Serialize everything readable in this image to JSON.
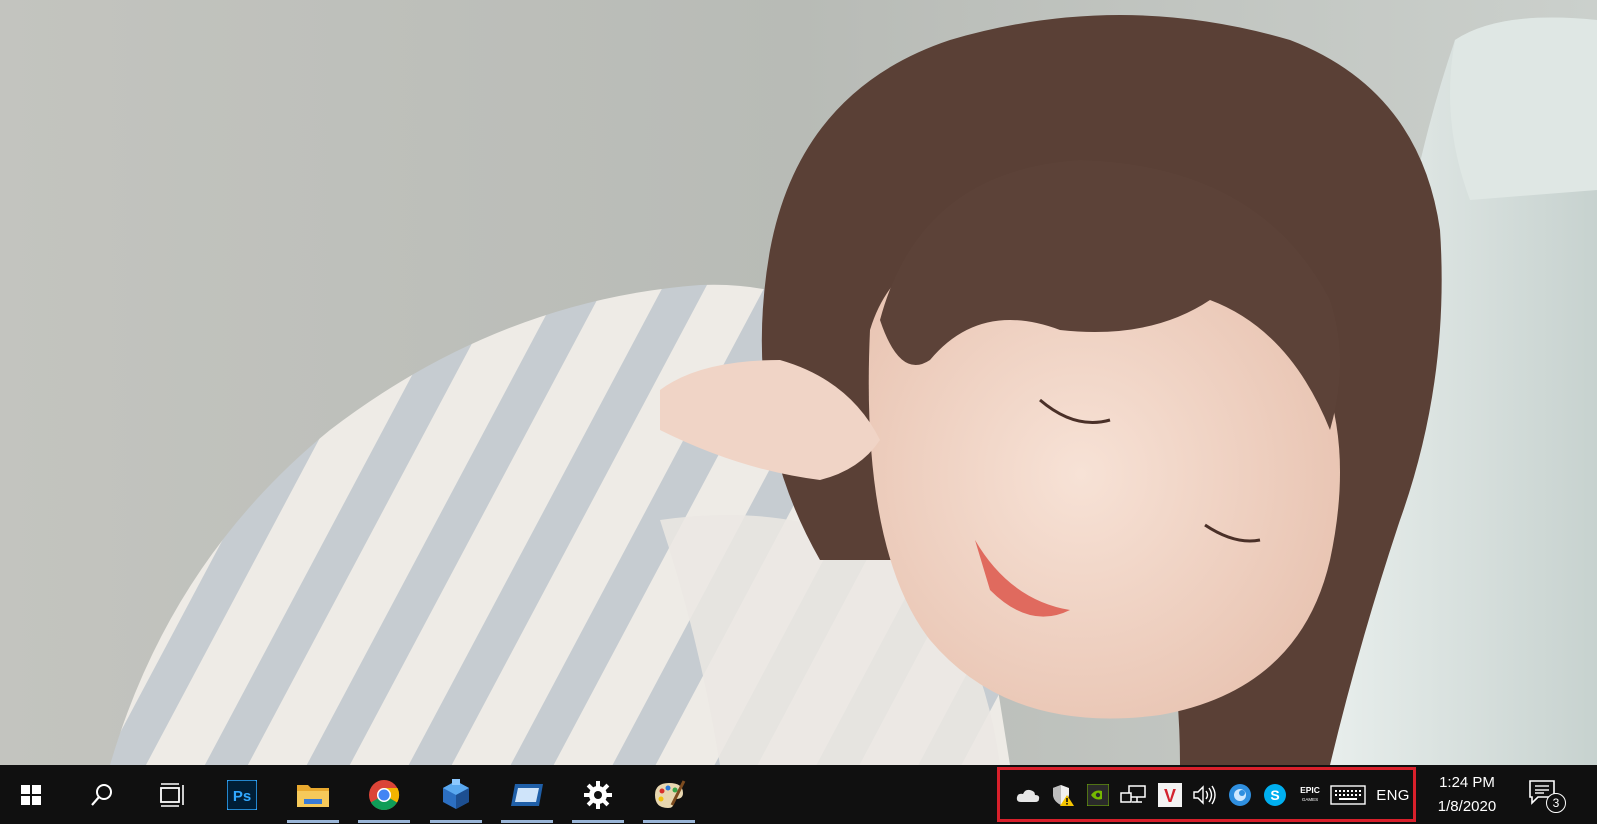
{
  "taskbar": {
    "start_label": "Start",
    "search_label": "Search",
    "task_view_label": "Task View",
    "pinned": [
      {
        "name": "photoshop",
        "glyph": "Ps",
        "color": "#31a8ff"
      },
      {
        "name": "file-explorer",
        "color": "#f4c152"
      },
      {
        "name": "chrome"
      },
      {
        "name": "app-cube",
        "color": "#3a8fe0"
      },
      {
        "name": "app-window",
        "color": "#3a8fe0"
      },
      {
        "name": "settings"
      },
      {
        "name": "paint"
      }
    ],
    "tray": {
      "icons": [
        "onedrive-icon",
        "defender-warning-icon",
        "nvidia-icon",
        "network-icon",
        "v-app-icon",
        "volume-icon",
        "blue-circle-app-icon",
        "skype-icon",
        "epic-games-icon",
        "touch-keyboard-icon"
      ],
      "vapp_glyph": "V",
      "skype_glyph": "S",
      "epic_glyph_top": "EPIC",
      "epic_glyph_bottom": "GAMES",
      "language": "ENG",
      "highlight_color": "#d9202b"
    },
    "clock": {
      "time": "1:24 PM",
      "date": "1/8/2020"
    },
    "notifications": {
      "count": "3"
    }
  }
}
